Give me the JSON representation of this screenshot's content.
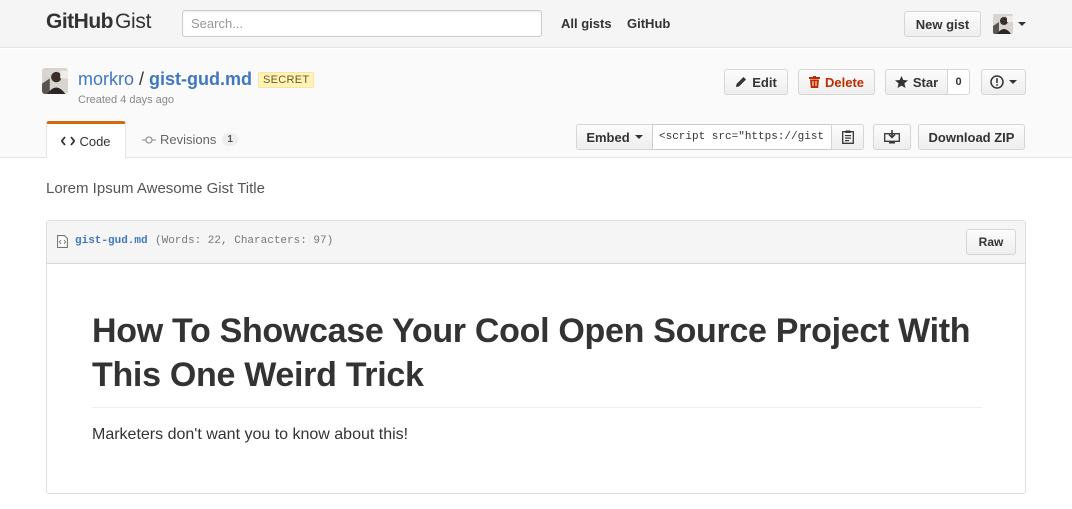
{
  "header": {
    "logo_bold": "GitHub",
    "logo_light": "Gist",
    "search_placeholder": "Search...",
    "nav": [
      "All gists",
      "GitHub"
    ],
    "new_gist_label": "New gist"
  },
  "gist": {
    "owner": "morkro",
    "separator": "/",
    "filename": "gist-gud.md",
    "visibility_badge": "SECRET",
    "created": "Created 4 days ago",
    "actions": {
      "edit_label": "Edit",
      "delete_label": "Delete",
      "star_label": "Star",
      "star_count": "0"
    },
    "tabs": {
      "code_label": "Code",
      "revisions_label": "Revisions",
      "revisions_count": "1"
    },
    "embed_label": "Embed",
    "embed_value": "<script src=\"https://gist",
    "download_zip_label": "Download ZIP",
    "description": "Lorem Ipsum Awesome Gist Title"
  },
  "file": {
    "name": "gist-gud.md",
    "meta": "(Words: 22, Characters: 97)",
    "raw_label": "Raw",
    "heading": "How To Showcase Your Cool Open Source Project With This One Weird Trick",
    "paragraph": "Marketers don't want you to know about this!"
  },
  "colors": {
    "link": "#4078c0",
    "delete": "#bd2c00",
    "active_tab_border": "#d26911",
    "secret_badge_bg": "#fff3b8"
  }
}
